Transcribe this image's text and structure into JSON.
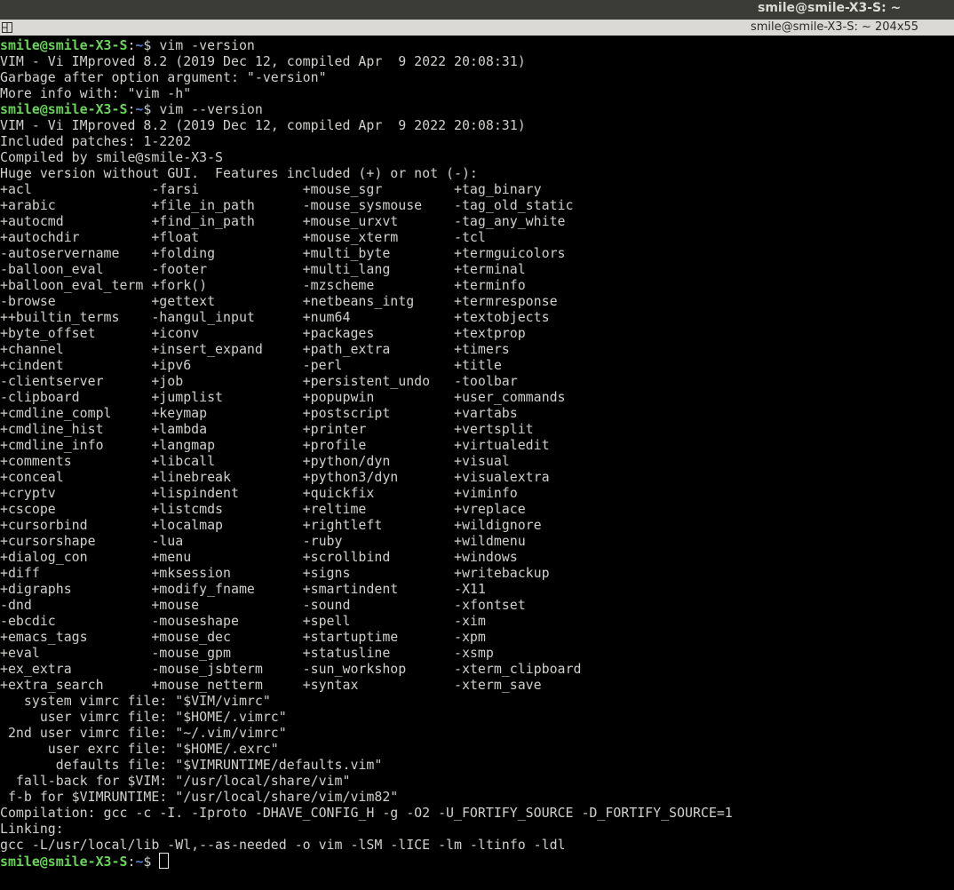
{
  "system_bar": {
    "title": "smile@smile-X3-S: ~"
  },
  "window": {
    "title": "smile@smile-X3-S: ~ 204x55"
  },
  "terminal": {
    "prompt_user": "smile@smile-X3-S",
    "prompt_sep": ":",
    "prompt_path": "~",
    "lines": [
      {
        "type": "prompt",
        "cmd": "vim -version"
      },
      {
        "type": "out",
        "text": "VIM - Vi IMproved 8.2 (2019 Dec 12, compiled Apr  9 2022 20:08:31)"
      },
      {
        "type": "out",
        "text": "Garbage after option argument: \"-version\""
      },
      {
        "type": "out",
        "text": "More info with: \"vim -h\""
      },
      {
        "type": "prompt",
        "cmd": "vim --version"
      },
      {
        "type": "out",
        "text": "VIM - Vi IMproved 8.2 (2019 Dec 12, compiled Apr  9 2022 20:08:31)"
      },
      {
        "type": "out",
        "text": "Included patches: 1-2202"
      },
      {
        "type": "out",
        "text": "Compiled by smile@smile-X3-S"
      },
      {
        "type": "out",
        "text": "Huge version without GUI.  Features included (+) or not (-):"
      },
      {
        "type": "out",
        "text": "+acl               -farsi             +mouse_sgr         +tag_binary"
      },
      {
        "type": "out",
        "text": "+arabic            +file_in_path      -mouse_sysmouse    -tag_old_static"
      },
      {
        "type": "out",
        "text": "+autocmd           +find_in_path      +mouse_urxvt       -tag_any_white"
      },
      {
        "type": "out",
        "text": "+autochdir         +float             +mouse_xterm       -tcl"
      },
      {
        "type": "out",
        "text": "-autoservername    +folding           +multi_byte        +termguicolors"
      },
      {
        "type": "out",
        "text": "-balloon_eval      -footer            +multi_lang        +terminal"
      },
      {
        "type": "out",
        "text": "+balloon_eval_term +fork()            -mzscheme          +terminfo"
      },
      {
        "type": "out",
        "text": "-browse            +gettext           +netbeans_intg     +termresponse"
      },
      {
        "type": "out",
        "text": "++builtin_terms    -hangul_input      +num64             +textobjects"
      },
      {
        "type": "out",
        "text": "+byte_offset       +iconv             +packages          +textprop"
      },
      {
        "type": "out",
        "text": "+channel           +insert_expand     +path_extra        +timers"
      },
      {
        "type": "out",
        "text": "+cindent           +ipv6              -perl              +title"
      },
      {
        "type": "out",
        "text": "-clientserver      +job               +persistent_undo   -toolbar"
      },
      {
        "type": "out",
        "text": "-clipboard         +jumplist          +popupwin          +user_commands"
      },
      {
        "type": "out",
        "text": "+cmdline_compl     +keymap            +postscript        +vartabs"
      },
      {
        "type": "out",
        "text": "+cmdline_hist      +lambda            +printer           +vertsplit"
      },
      {
        "type": "out",
        "text": "+cmdline_info      +langmap           +profile           +virtualedit"
      },
      {
        "type": "out",
        "text": "+comments          +libcall           +python/dyn        +visual"
      },
      {
        "type": "out",
        "text": "+conceal           +linebreak         +python3/dyn       +visualextra"
      },
      {
        "type": "out",
        "text": "+cryptv            +lispindent        +quickfix          +viminfo"
      },
      {
        "type": "out",
        "text": "+cscope            +listcmds          +reltime           +vreplace"
      },
      {
        "type": "out",
        "text": "+cursorbind        +localmap          +rightleft         +wildignore"
      },
      {
        "type": "out",
        "text": "+cursorshape       -lua               -ruby              +wildmenu"
      },
      {
        "type": "out",
        "text": "+dialog_con        +menu              +scrollbind        +windows"
      },
      {
        "type": "out",
        "text": "+diff              +mksession         +signs             +writebackup"
      },
      {
        "type": "out",
        "text": "+digraphs          +modify_fname      +smartindent       -X11"
      },
      {
        "type": "out",
        "text": "-dnd               +mouse             -sound             -xfontset"
      },
      {
        "type": "out",
        "text": "-ebcdic            -mouseshape        +spell             -xim"
      },
      {
        "type": "out",
        "text": "+emacs_tags        +mouse_dec         +startuptime       -xpm"
      },
      {
        "type": "out",
        "text": "+eval              -mouse_gpm         +statusline        -xsmp"
      },
      {
        "type": "out",
        "text": "+ex_extra          -mouse_jsbterm     -sun_workshop      -xterm_clipboard"
      },
      {
        "type": "out",
        "text": "+extra_search      +mouse_netterm     +syntax            -xterm_save"
      },
      {
        "type": "out",
        "text": "   system vimrc file: \"$VIM/vimrc\""
      },
      {
        "type": "out",
        "text": "     user vimrc file: \"$HOME/.vimrc\""
      },
      {
        "type": "out",
        "text": " 2nd user vimrc file: \"~/.vim/vimrc\""
      },
      {
        "type": "out",
        "text": "      user exrc file: \"$HOME/.exrc\""
      },
      {
        "type": "out",
        "text": "       defaults file: \"$VIMRUNTIME/defaults.vim\""
      },
      {
        "type": "out",
        "text": "  fall-back for $VIM: \"/usr/local/share/vim\""
      },
      {
        "type": "out",
        "text": " f-b for $VIMRUNTIME: \"/usr/local/share/vim/vim82\""
      },
      {
        "type": "out",
        "text": "Compilation: gcc -c -I. -Iproto -DHAVE_CONFIG_H -g -O2 -U_FORTIFY_SOURCE -D_FORTIFY_SOURCE=1"
      },
      {
        "type": "out",
        "text": "Linking:"
      },
      {
        "type": "out",
        "text": "gcc -L/usr/local/lib -Wl,--as-needed -o vim -lSM -lICE -lm -ltinfo -ldl"
      },
      {
        "type": "prompt",
        "cmd": "",
        "cursor": true
      }
    ]
  },
  "colors": {
    "background": "#000000",
    "text": "#cfd0cc",
    "prompt_user": "#6ad35a",
    "prompt_path": "#5c7fd6"
  }
}
